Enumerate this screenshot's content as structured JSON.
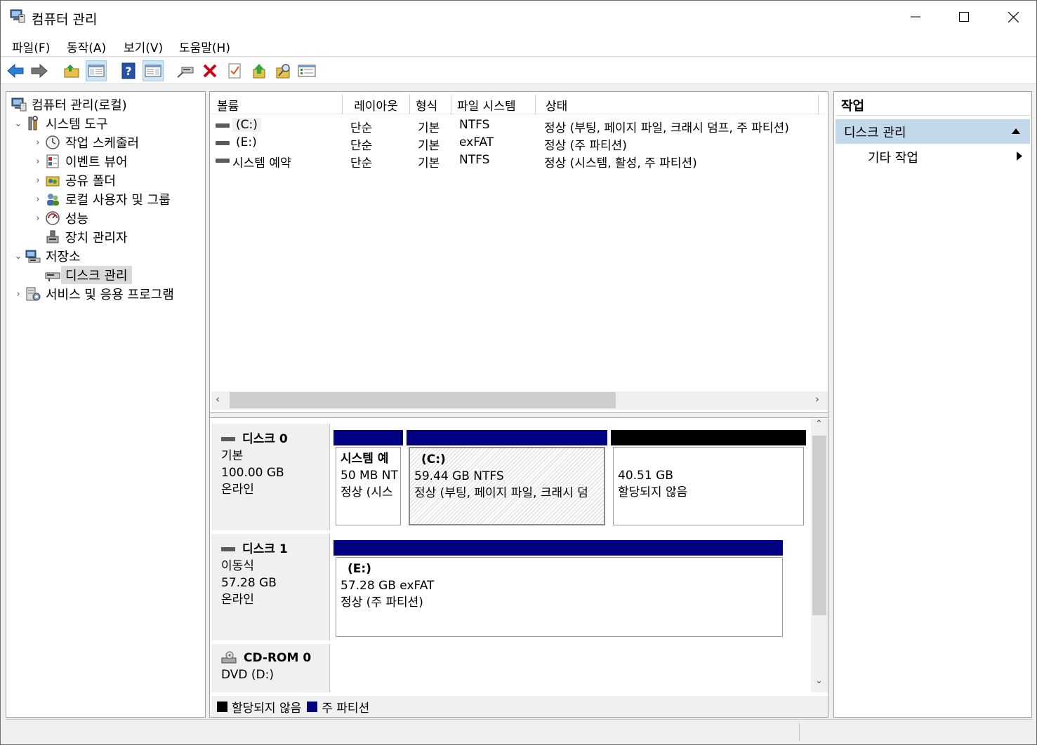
{
  "window": {
    "title": "컴퓨터 관리"
  },
  "menu": [
    "파일(F)",
    "동작(A)",
    "보기(V)",
    "도움말(H)"
  ],
  "toolbar_icons": [
    "back-icon",
    "forward-icon",
    "up-folder-icon",
    "show-hide-tree-icon",
    "help-icon",
    "show-hide-action-pane-icon",
    "connect-icon",
    "delete-icon",
    "check-icon",
    "upload-icon",
    "search-icon",
    "properties-icon"
  ],
  "tree": {
    "root": "컴퓨터 관리(로컬)",
    "system_tools": "시스템 도구",
    "task_scheduler": "작업 스케줄러",
    "event_viewer": "이벤트 뷰어",
    "shared_folders": "공유 폴더",
    "local_users": "로컬 사용자 및 그룹",
    "performance": "성능",
    "device_manager": "장치 관리자",
    "storage": "저장소",
    "disk_management": "디스크 관리",
    "services": "서비스 및 응용 프로그램"
  },
  "columns": [
    "볼륨",
    "레이아웃",
    "형식",
    "파일 시스템",
    "상태"
  ],
  "volumes": [
    {
      "name": "(C:)",
      "layout": "단순",
      "type": "기본",
      "fs": "NTFS",
      "status": "정상 (부팅, 페이지 파일, 크래시 덤프, 주 파티션)"
    },
    {
      "name": "(E:)",
      "layout": "단순",
      "type": "기본",
      "fs": "exFAT",
      "status": "정상 (주 파티션)"
    },
    {
      "name": "시스템 예약",
      "layout": "단순",
      "type": "기본",
      "fs": "NTFS",
      "status": "정상 (시스템, 활성, 주 파티션)"
    }
  ],
  "disks": {
    "disk0": {
      "name": "디스크 0",
      "kind": "기본",
      "size": "100.00 GB",
      "state": "온라인"
    },
    "disk1": {
      "name": "디스크 1",
      "kind": "이동식",
      "size": "57.28 GB",
      "state": "온라인"
    },
    "cdrom0": {
      "name": "CD-ROM 0",
      "kind": "DVD (D:)"
    }
  },
  "partitions": {
    "sysres": {
      "title": "시스템 예",
      "line1": "50 MB NT",
      "line2": "정상 (시스"
    },
    "c": {
      "title": "(C:)",
      "line1": "59.44 GB NTFS",
      "line2": "정상 (부팅, 페이지 파일, 크래시 덤"
    },
    "unalloc": {
      "line1": "40.51 GB",
      "line2": "할당되지 않음"
    },
    "e": {
      "title": "(E:)",
      "line1": "57.28 GB exFAT",
      "line2": "정상 (주 파티션)"
    }
  },
  "legend": {
    "unallocated": "할당되지 않음",
    "primary": "주 파티션"
  },
  "colors": {
    "primary": "#000080",
    "unallocated": "#000000",
    "selection": "#c4d8ec"
  },
  "actions": {
    "header": "작업",
    "section": "디스크 관리",
    "item": "기타 작업"
  }
}
